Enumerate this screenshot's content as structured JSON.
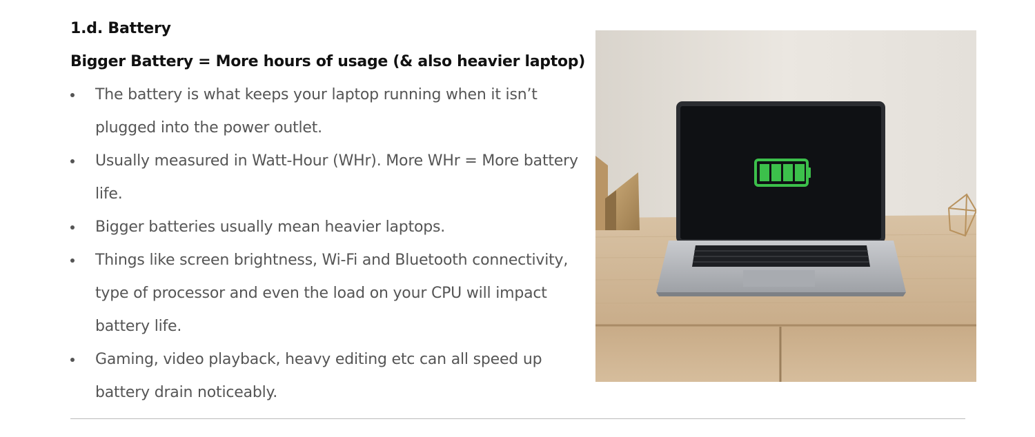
{
  "section": {
    "title": "1.d. Battery",
    "subtitle": "Bigger Battery = More hours of usage (& also heavier laptop)"
  },
  "bullets": [
    {
      "text": "The battery is what keeps your laptop running when it isn’t plugged into the power outlet."
    },
    {
      "text": "Usually measured in Watt-Hour (WHr). More WHr = More battery life."
    },
    {
      "text": "Bigger batteries usually mean heavier laptops."
    },
    {
      "text": "Things like screen brightness, Wi-Fi and Bluetooth connectivity, type of processor and even the load on your CPU will impact battery life."
    },
    {
      "text": "Gaming, video playback, heavy editing etc can all speed up battery drain noticeably."
    }
  ],
  "image": {
    "battery_level": 1.0,
    "battery_color": "#3cc04b"
  },
  "colors": {
    "heading": "#111111",
    "body_text": "#555555",
    "divider": "#bbbbbb"
  }
}
